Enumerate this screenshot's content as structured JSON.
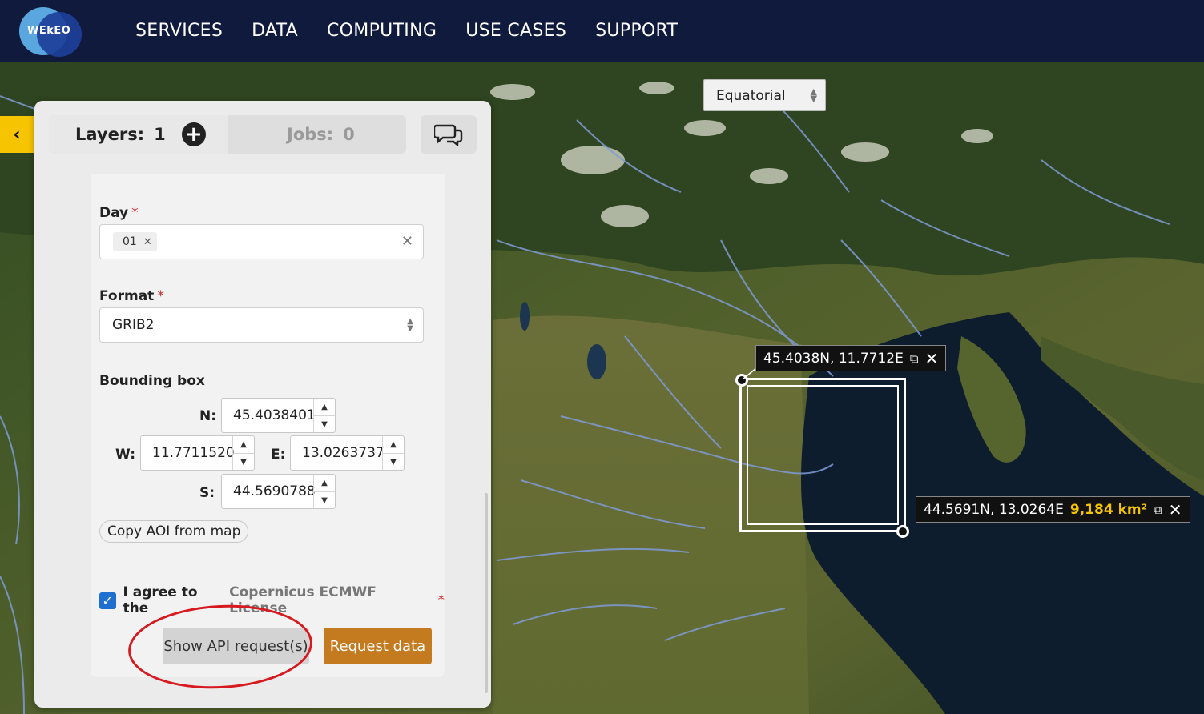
{
  "nav": {
    "logo_text": "WEkEO",
    "items": [
      "SERVICES",
      "DATA",
      "COMPUTING",
      "USE CASES",
      "SUPPORT"
    ]
  },
  "map": {
    "projection": "Equatorial",
    "top_left_coord": "45.4038N, 11.7712E",
    "bottom_right_coord": "44.5691N, 13.0264E",
    "area": "9,184 km²"
  },
  "panel": {
    "layers_label": "Layers:",
    "layers_count": "1",
    "jobs_label": "Jobs:",
    "jobs_count": "0",
    "day": {
      "label": "Day",
      "required": "*",
      "chip": "01"
    },
    "format": {
      "label": "Format",
      "required": "*",
      "value": "GRIB2"
    },
    "bbox": {
      "label": "Bounding box",
      "n_label": "N:",
      "n": "45.4038401",
      "w_label": "W:",
      "w": "11.7711520",
      "e_label": "E:",
      "e": "13.0263737",
      "s_label": "S:",
      "s": "44.5690788"
    },
    "copy_aoi": "Copy AOI from map",
    "agree_text": "I agree to the",
    "license": "Copernicus ECMWF License",
    "agree_required": "*",
    "show_api": "Show API request(s)",
    "request": "Request data"
  },
  "colors": {
    "nav_bg": "#0f1a3d",
    "accent_yellow": "#f6c400",
    "request_btn": "#c47a1e",
    "annotation_red": "#d71920",
    "checkbox": "#1e6fd0"
  },
  "icons": [
    "chevron-left-icon",
    "plus-circle-icon",
    "chat-bubbles-icon",
    "copy-icon",
    "close-icon",
    "clear-icon",
    "sort-icon",
    "checkmark-icon"
  ]
}
